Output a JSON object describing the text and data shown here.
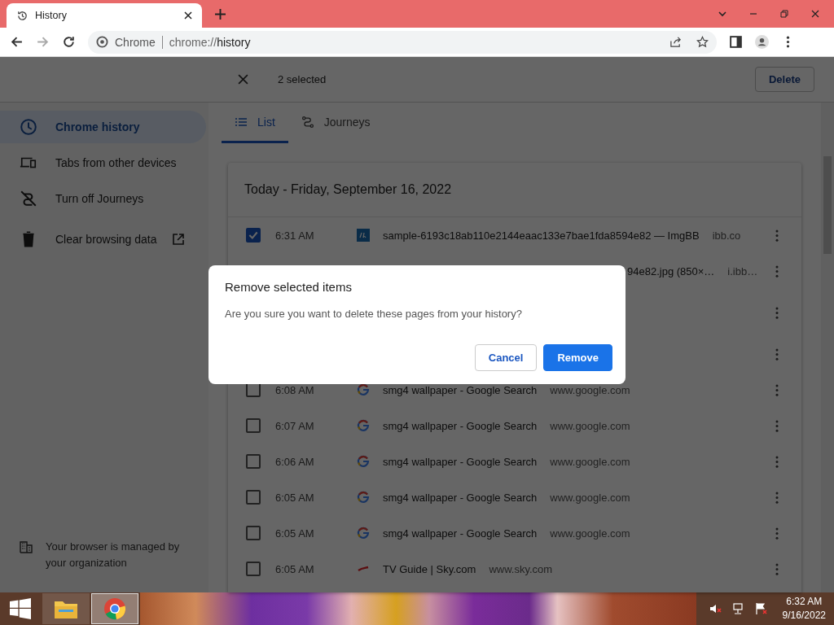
{
  "tab": {
    "title": "History"
  },
  "address": {
    "site_label": "Chrome",
    "url_prefix": "chrome://",
    "url_path": "history"
  },
  "selection_bar": {
    "count": "2 selected",
    "action": "Delete"
  },
  "sidebar": {
    "items": [
      {
        "label": "Chrome history",
        "selected": true,
        "external_link": false
      },
      {
        "label": "Tabs from other devices",
        "selected": false,
        "external_link": false
      },
      {
        "label": "Turn off Journeys",
        "selected": false,
        "external_link": false
      },
      {
        "label": "Clear browsing data",
        "selected": false,
        "external_link": true
      }
    ],
    "managed_note": "Your browser is managed by your organization"
  },
  "view_tabs": [
    {
      "label": "List",
      "selected": true
    },
    {
      "label": "Journeys",
      "selected": false
    }
  ],
  "history": {
    "heading": "Today - Friday, September 16, 2022",
    "rows": [
      {
        "kind": "imgbb",
        "checked": true,
        "time": "6:31 AM",
        "title": "sample-6193c18ab110e2144eaac133e7bae1fda8594e82 — ImgBB",
        "domain": "ibb.co"
      },
      {
        "kind": "partial",
        "title": "94e82.jpg (850×…",
        "domain": "i.ibb…"
      },
      {
        "kind": "hidden"
      },
      {
        "kind": "hidden"
      },
      {
        "kind": "google",
        "checked": false,
        "time": "6:08 AM",
        "title": "smg4 wallpaper - Google Search",
        "domain": "www.google.com"
      },
      {
        "kind": "google",
        "checked": false,
        "time": "6:07 AM",
        "title": "smg4 wallpaper - Google Search",
        "domain": "www.google.com"
      },
      {
        "kind": "google",
        "checked": false,
        "time": "6:06 AM",
        "title": "smg4 wallpaper - Google Search",
        "domain": "www.google.com"
      },
      {
        "kind": "google",
        "checked": false,
        "time": "6:05 AM",
        "title": "smg4 wallpaper - Google Search",
        "domain": "www.google.com"
      },
      {
        "kind": "google",
        "checked": false,
        "time": "6:05 AM",
        "title": "smg4 wallpaper - Google Search",
        "domain": "www.google.com"
      },
      {
        "kind": "sky",
        "checked": false,
        "time": "6:05 AM",
        "title": "TV Guide | Sky.com",
        "domain": "www.sky.com"
      }
    ]
  },
  "dialog": {
    "title": "Remove selected items",
    "message": "Are you sure you want to delete these pages from your history?",
    "cancel": "Cancel",
    "confirm": "Remove"
  },
  "taskbar": {
    "time": "6:32 AM",
    "date": "9/16/2022"
  }
}
